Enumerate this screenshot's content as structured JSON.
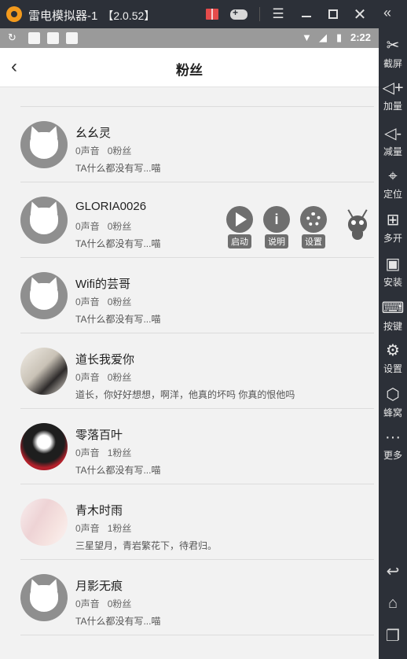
{
  "window": {
    "title": "雷电模拟器-1",
    "version": "【2.0.52】"
  },
  "status_bar": {
    "time": "2:22"
  },
  "app_bar": {
    "title": "粉丝"
  },
  "followers": [
    {
      "name": "幺幺灵",
      "voices": "0声音",
      "fans": "0粉丝",
      "bio": "TA什么都没有写...喵",
      "avatar": "default-cat"
    },
    {
      "name": "GLORIA0026",
      "voices": "0声音",
      "fans": "0粉丝",
      "bio": "TA什么都没有写...喵",
      "avatar": "default-cat"
    },
    {
      "name": "Wifi的芸哥",
      "voices": "0声音",
      "fans": "0粉丝",
      "bio": "TA什么都没有写...喵",
      "avatar": "default-cat"
    },
    {
      "name": "道长我爱你",
      "voices": "0声音",
      "fans": "0粉丝",
      "bio": "道长，你好好想想，啊洋，他真的坏吗 你真的恨他吗",
      "avatar": "photo"
    },
    {
      "name": "零落百叶",
      "voices": "0声音",
      "fans": "1粉丝",
      "bio": "TA什么都没有写...喵",
      "avatar": "photo"
    },
    {
      "name": "青木时雨",
      "voices": "0声音",
      "fans": "1粉丝",
      "bio": "三星望月，青岩繁花下，待君归。",
      "avatar": "photo"
    },
    {
      "name": "月影无痕",
      "voices": "0声音",
      "fans": "0粉丝",
      "bio": "TA什么都没有写...喵",
      "avatar": "default-cat"
    }
  ],
  "overlay": {
    "start_label": "启动",
    "info_label": "说明",
    "settings_label": "设置"
  },
  "sidebar": {
    "items": [
      {
        "label": "截屏",
        "icon": "scissors-icon"
      },
      {
        "label": "加量",
        "icon": "volume-up-icon"
      },
      {
        "label": "减量",
        "icon": "volume-down-icon"
      },
      {
        "label": "定位",
        "icon": "location-icon"
      },
      {
        "label": "多开",
        "icon": "multi-instance-icon"
      },
      {
        "label": "安装",
        "icon": "apk-install-icon"
      },
      {
        "label": "按键",
        "icon": "keyboard-icon"
      },
      {
        "label": "设置",
        "icon": "gear-icon"
      },
      {
        "label": "蜂窝",
        "icon": "hive-icon"
      },
      {
        "label": "更多",
        "icon": "more-icon"
      }
    ]
  }
}
